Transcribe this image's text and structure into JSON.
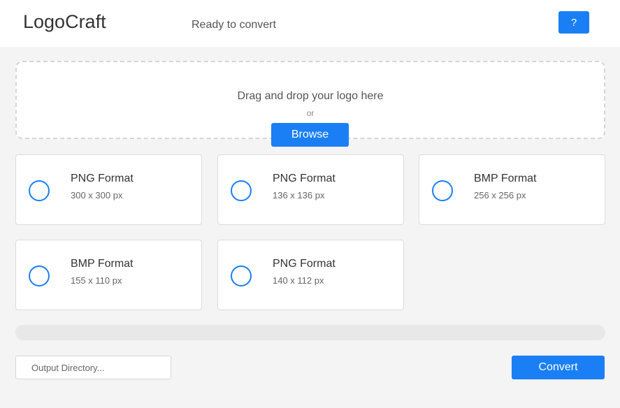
{
  "header": {
    "title": "LogoCraft",
    "status": "Ready to convert",
    "help_label": "?"
  },
  "dropzone": {
    "text": "Drag and drop your logo here",
    "or": "or",
    "browse_label": "Browse"
  },
  "formats": [
    {
      "format": "PNG Format",
      "size": "300 x 300 px"
    },
    {
      "format": "PNG Format",
      "size": "136 x 136 px"
    },
    {
      "format": "BMP Format",
      "size": "256 x 256 px"
    },
    {
      "format": "BMP Format",
      "size": "155 x 110 px"
    },
    {
      "format": "PNG Format",
      "size": "140 x 112 px"
    }
  ],
  "progress": {
    "value": 0
  },
  "output": {
    "placeholder": "Output Directory..."
  },
  "convert_label": "Convert",
  "colors": {
    "accent": "#1a7ff5",
    "background": "#f4f4f4"
  },
  "icons": {
    "format_option": "radio-circle-icon"
  }
}
